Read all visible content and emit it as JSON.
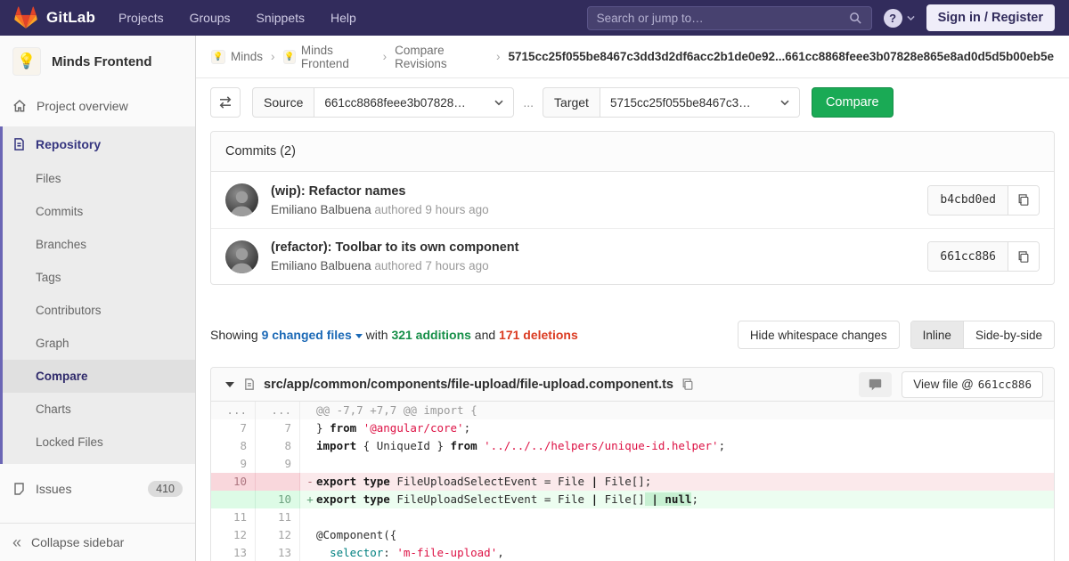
{
  "colors": {
    "navbar_bg": "#322c5c",
    "compare_button_green": "#1aaa55",
    "additions_green": "#168f48",
    "deletions_red": "#db3b21",
    "link_blue": "#1b69b6",
    "diff_add_bg": "#ecfdf0",
    "diff_del_bg": "#fbe9eb"
  },
  "navbar": {
    "brand": "GitLab",
    "links": [
      "Projects",
      "Groups",
      "Snippets",
      "Help"
    ],
    "search_placeholder": "Search or jump to…",
    "help_glyph": "?",
    "sign_in": "Sign in / Register"
  },
  "sidebar": {
    "project_avatar": "💡",
    "project_name": "Minds Frontend",
    "overview_label": "Project overview",
    "repository": {
      "label": "Repository",
      "items": [
        "Files",
        "Commits",
        "Branches",
        "Tags",
        "Contributors",
        "Graph",
        "Compare",
        "Charts",
        "Locked Files"
      ],
      "active_item": "Compare"
    },
    "issues_label": "Issues",
    "issues_count": "410",
    "collapse_label": "Collapse sidebar",
    "collapse_glyph": "«"
  },
  "breadcrumb": {
    "items": [
      {
        "label": "Minds",
        "avatar": "💡"
      },
      {
        "label": "Minds Frontend",
        "avatar": "💡"
      },
      {
        "label": "Compare Revisions",
        "avatar": ""
      }
    ],
    "separator": "›",
    "current": "5715cc25f055be8467c3dd3d2df6acc2b1de0e92...661cc8868feee3b07828e865e8ad0d5d5b00eb5e"
  },
  "compare_form": {
    "source_label": "Source",
    "source_value": "661cc8868feee3b07828…",
    "dots": "...",
    "target_label": "Target",
    "target_value": "5715cc25f055be8467c3…",
    "compare_button": "Compare"
  },
  "commits_panel": {
    "title": "Commits (2)",
    "commits": [
      {
        "title": "(wip): Refactor names",
        "author": "Emiliano Balbuena",
        "authored": "authored 9 hours ago",
        "sha": "b4cbd0ed"
      },
      {
        "title": "(refactor): Toolbar to its own component",
        "author": "Emiliano Balbuena",
        "authored": "authored 7 hours ago",
        "sha": "661cc886"
      }
    ]
  },
  "showing": {
    "prefix": "Showing",
    "files": "9 changed files",
    "with": "with",
    "additions": "321 additions",
    "and": "and",
    "deletions": "171 deletions",
    "hide_whitespace": "Hide whitespace changes",
    "inline": "Inline",
    "side_by_side": "Side-by-side"
  },
  "diff_file": {
    "path": "src/app/common/components/file-upload/file-upload.component.ts",
    "view_file_label": "View file @",
    "view_file_sha": "661cc886",
    "lines": [
      {
        "type": "match",
        "old": "...",
        "new": "...",
        "marker": "",
        "code": [
          [
            "@@ -7,7 +7,7 @@ import {",
            ""
          ]
        ]
      },
      {
        "type": "ctx",
        "old": "7",
        "new": "7",
        "marker": "",
        "code": [
          [
            "} ",
            ""
          ],
          [
            "from",
            "k"
          ],
          [
            " ",
            ""
          ],
          [
            "'@angular/core'",
            "s"
          ],
          [
            ";",
            ""
          ]
        ]
      },
      {
        "type": "ctx",
        "old": "8",
        "new": "8",
        "marker": "",
        "code": [
          [
            "import",
            "k"
          ],
          [
            " { UniqueId } ",
            ""
          ],
          [
            "from",
            "k"
          ],
          [
            " ",
            ""
          ],
          [
            "'../../../helpers/unique-id.helper'",
            "s"
          ],
          [
            ";",
            ""
          ]
        ]
      },
      {
        "type": "ctx",
        "old": "9",
        "new": "9",
        "marker": "",
        "code": []
      },
      {
        "type": "del",
        "old": "10",
        "new": "",
        "marker": "-",
        "code": [
          [
            "export",
            "k"
          ],
          [
            " ",
            ""
          ],
          [
            "type",
            "k"
          ],
          [
            " FileUploadSelectEvent = File ",
            ""
          ],
          [
            "|",
            "k"
          ],
          [
            " File[];",
            ""
          ]
        ]
      },
      {
        "type": "add",
        "old": "",
        "new": "10",
        "marker": "+",
        "code": [
          [
            "export",
            "k"
          ],
          [
            " ",
            ""
          ],
          [
            "type",
            "k"
          ],
          [
            " FileUploadSelectEvent = File ",
            ""
          ],
          [
            "|",
            "k"
          ],
          [
            " File[]",
            ""
          ],
          [
            " | null",
            "k hl"
          ],
          [
            ";",
            ""
          ]
        ]
      },
      {
        "type": "ctx",
        "old": "11",
        "new": "11",
        "marker": "",
        "code": []
      },
      {
        "type": "ctx",
        "old": "12",
        "new": "12",
        "marker": "",
        "code": [
          [
            "@Component({",
            ""
          ]
        ]
      },
      {
        "type": "ctx",
        "old": "13",
        "new": "13",
        "marker": "",
        "code": [
          [
            "  ",
            ""
          ],
          [
            "selector",
            "na"
          ],
          [
            ": ",
            ""
          ],
          [
            "'m-file-upload'",
            "s"
          ],
          [
            ",",
            ""
          ]
        ]
      }
    ]
  }
}
